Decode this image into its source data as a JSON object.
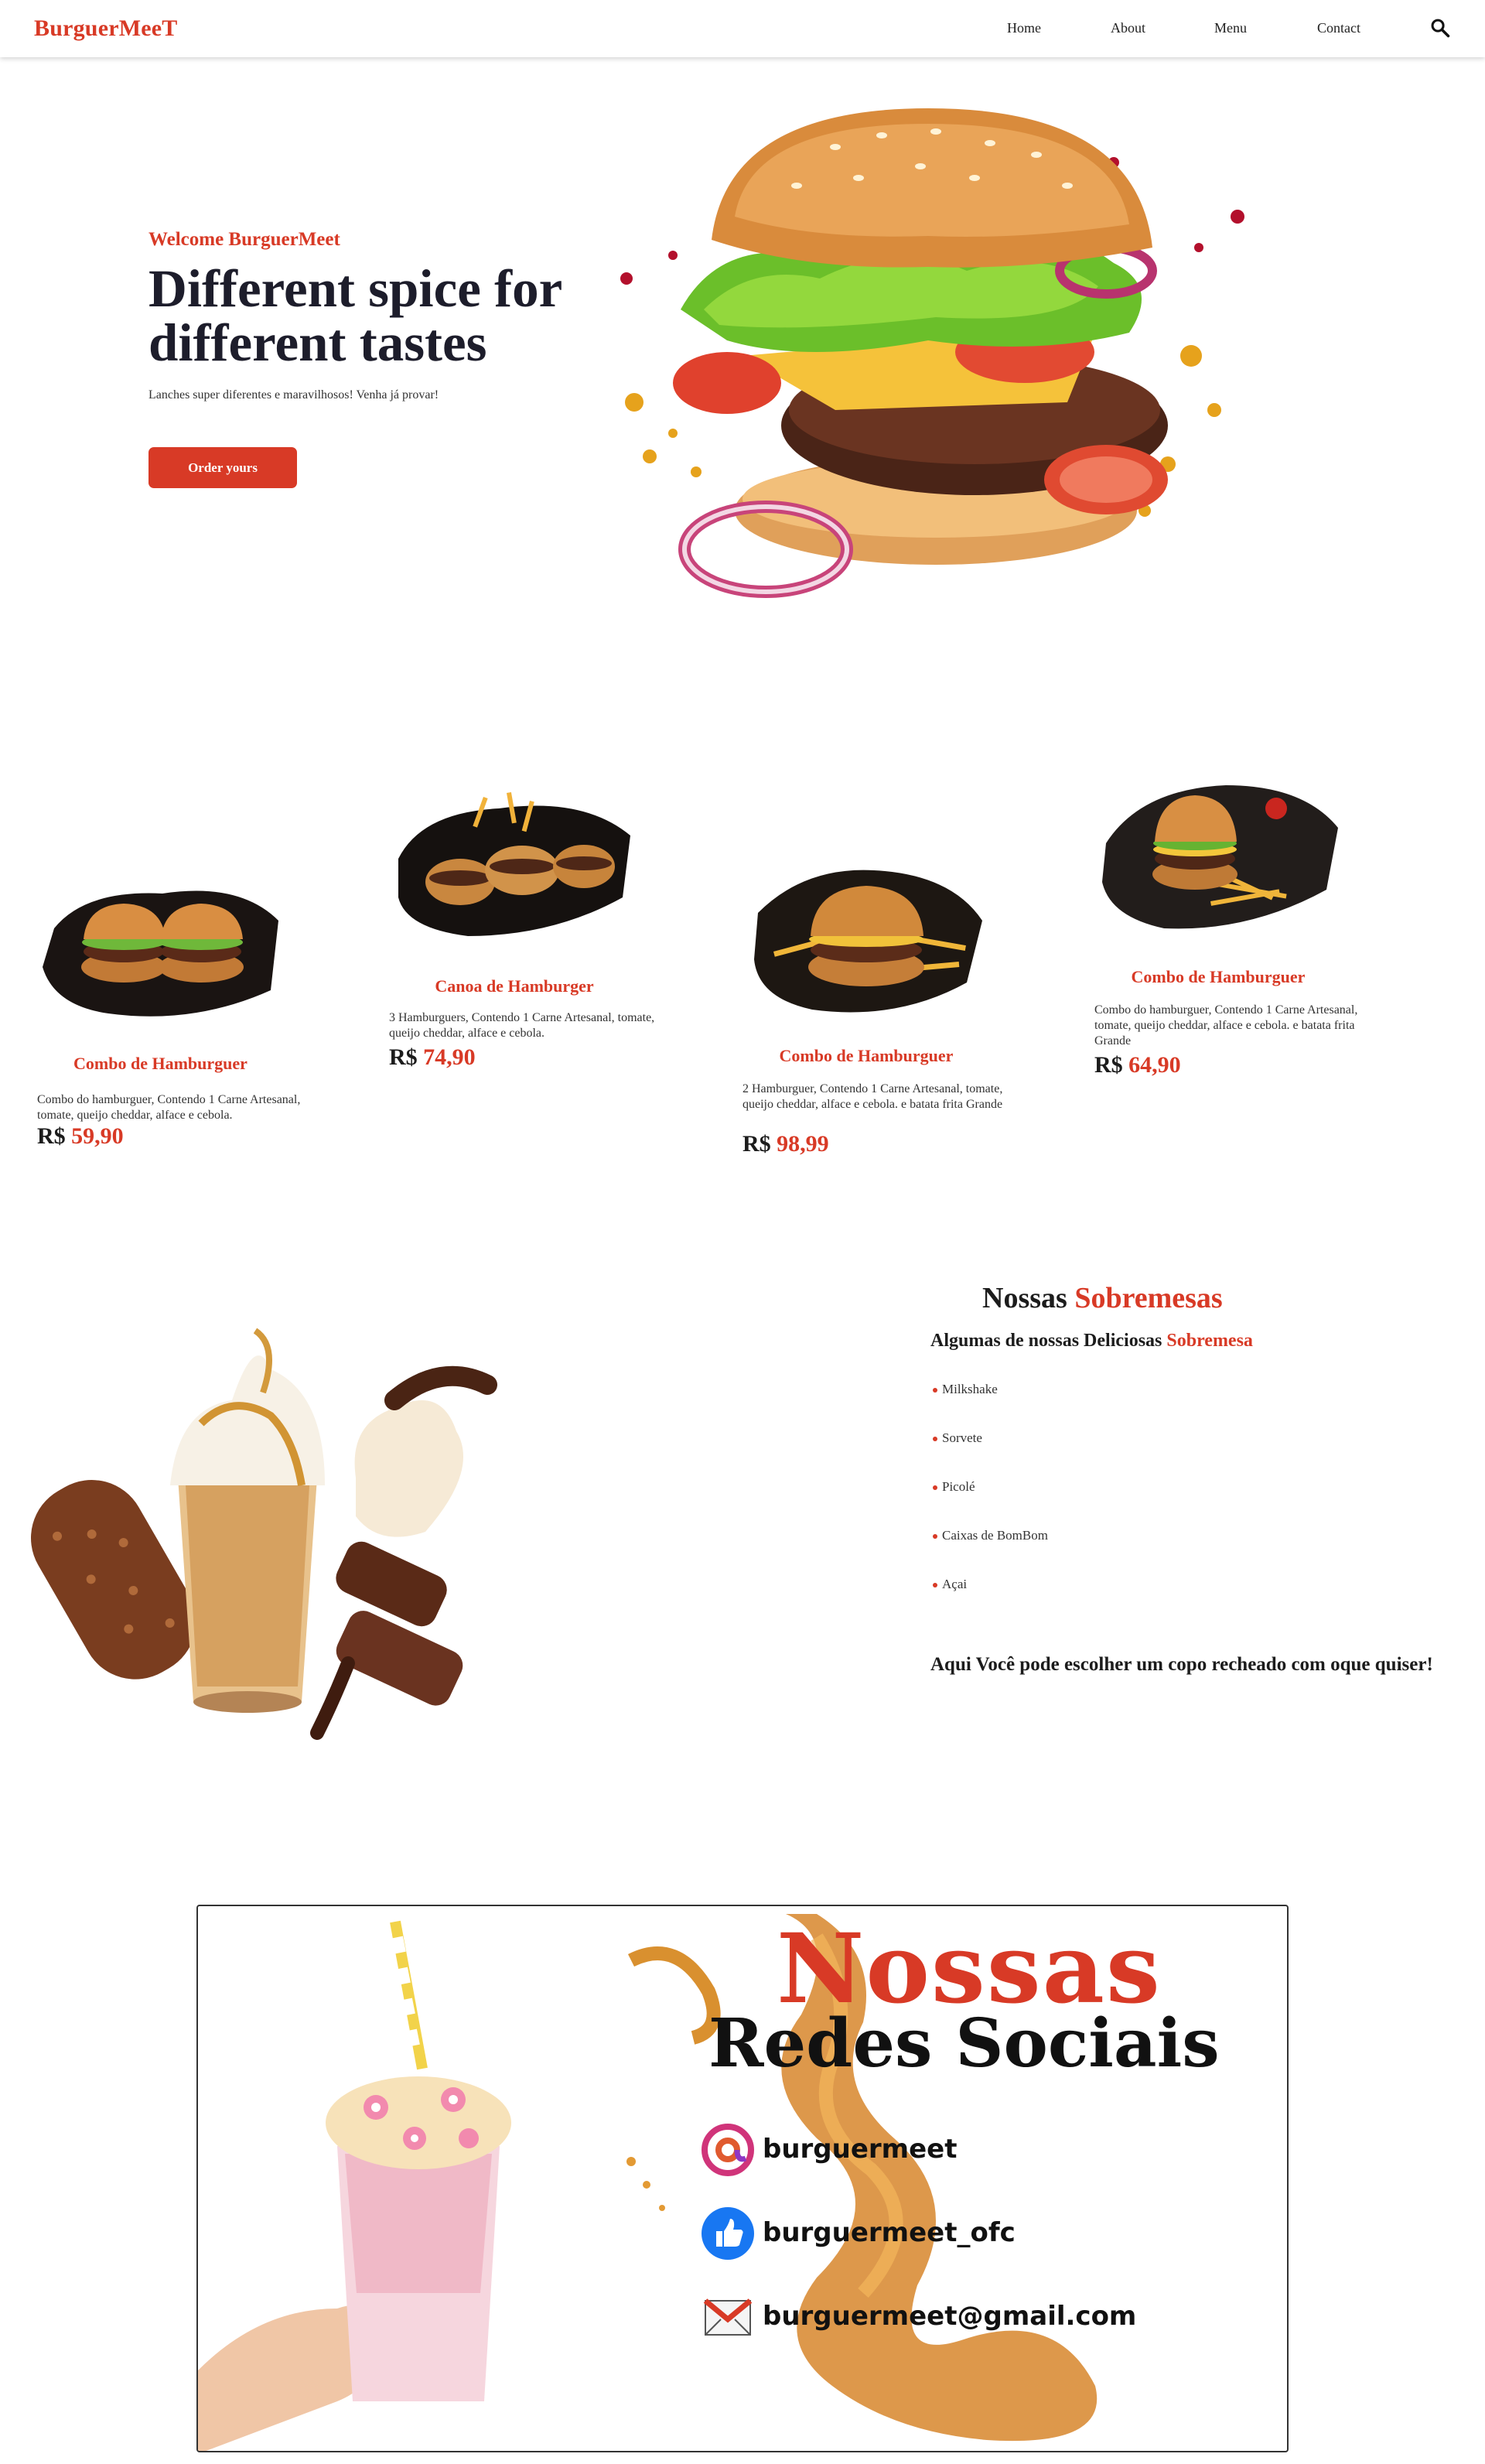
{
  "brand": {
    "logo_part1": "Burguer",
    "logo_part2": "Mee",
    "logo_part3": "T"
  },
  "nav": {
    "home": "Home",
    "about": "About",
    "menu": "Menu",
    "contact": "Contact",
    "search_icon": "search-icon"
  },
  "hero": {
    "welcome": "Welcome BurguerMeet",
    "title": "Different spice for different tastes",
    "subtitle": "Lanches super diferentes e maravilhosos! Venha já provar!",
    "cta": "Order yours"
  },
  "products": [
    {
      "title": "Combo de Hamburguer",
      "desc": "Combo do hamburguer, Contendo 1 Carne Artesanal, tomate, queijo cheddar, alface e cebola.",
      "currency": "R$",
      "price": "59,90"
    },
    {
      "title": "Canoa de Hamburger",
      "desc": "3 Hamburguers, Contendo 1 Carne Artesanal, tomate, queijo cheddar, alface e cebola.",
      "currency": "R$",
      "price": "74,90"
    },
    {
      "title": "Combo de Hamburguer",
      "desc": "2 Hamburguer, Contendo 1 Carne Artesanal, tomate, queijo cheddar, alface e cebola. e batata frita Grande",
      "currency": "R$",
      "price": "98,99"
    },
    {
      "title": "Combo de Hamburguer",
      "desc": "Combo do hamburguer, Contendo 1 Carne Artesanal, tomate, queijo cheddar, alface e cebola. e batata frita Grande",
      "currency": "R$",
      "price": "64,90"
    }
  ],
  "desserts": {
    "title_a": "Nossas",
    "title_b": "Sobremesas",
    "sub_a": "Algumas de nossas Deliciosas",
    "sub_b": "Sobremesa",
    "items": [
      "Milkshake",
      "Sorvete",
      "Picolé",
      "Caixas de BomBom",
      "Açai"
    ],
    "note": "Aqui Você pode escolher um copo recheado com oque quiser!"
  },
  "social": {
    "title1": "Nossas",
    "title2": "Redes Sociais",
    "instagram": "burguermeet",
    "facebook": "burguermeet_ofc",
    "email": "burguermeet@gmail.com"
  },
  "colors": {
    "accent": "#d83a26",
    "dark": "#1d1d2b"
  }
}
